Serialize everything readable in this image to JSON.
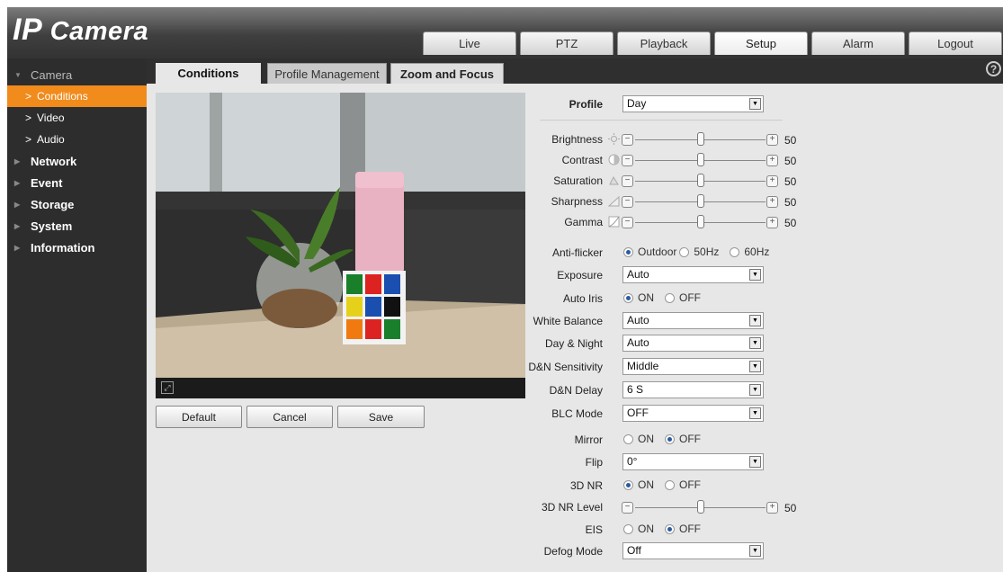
{
  "app": {
    "logo_ip": "IP",
    "logo_rest": " Camera"
  },
  "nav": {
    "tabs": [
      {
        "label": "Live",
        "active": false
      },
      {
        "label": "PTZ",
        "active": false
      },
      {
        "label": "Playback",
        "active": false
      },
      {
        "label": "Setup",
        "active": true
      },
      {
        "label": "Alarm",
        "active": false
      },
      {
        "label": "Logout",
        "active": false
      }
    ]
  },
  "sidebar": {
    "camera": "Camera",
    "sub": [
      "Conditions",
      "Video",
      "Audio"
    ],
    "items": [
      "Network",
      "Event",
      "Storage",
      "System",
      "Information"
    ]
  },
  "subtabs": {
    "conditions": "Conditions",
    "profile": "Profile Management",
    "zoom": "Zoom and Focus"
  },
  "buttons": {
    "default": "Default",
    "cancel": "Cancel",
    "save": "Save"
  },
  "settings": {
    "profile": {
      "label": "Profile",
      "value": "Day"
    },
    "brightness": {
      "label": "Brightness",
      "value": 50
    },
    "contrast": {
      "label": "Contrast",
      "value": 50
    },
    "saturation": {
      "label": "Saturation",
      "value": 50
    },
    "sharpness": {
      "label": "Sharpness",
      "value": 50
    },
    "gamma": {
      "label": "Gamma",
      "value": 50
    },
    "antiflicker": {
      "label": "Anti-flicker",
      "options": [
        "Outdoor",
        "50Hz",
        "60Hz"
      ],
      "selected": "Outdoor"
    },
    "exposure": {
      "label": "Exposure",
      "value": "Auto"
    },
    "autoiris": {
      "label": "Auto Iris",
      "options": [
        "ON",
        "OFF"
      ],
      "selected": "ON"
    },
    "whitebalance": {
      "label": "White Balance",
      "value": "Auto"
    },
    "daynight": {
      "label": "Day & Night",
      "value": "Auto"
    },
    "dnsens": {
      "label": "D&N Sensitivity",
      "value": "Middle"
    },
    "dndelay": {
      "label": "D&N Delay",
      "value": "6 S"
    },
    "blc": {
      "label": "BLC Mode",
      "value": "OFF"
    },
    "mirror": {
      "label": "Mirror",
      "options": [
        "ON",
        "OFF"
      ],
      "selected": "OFF"
    },
    "flip": {
      "label": "Flip",
      "value": "0°"
    },
    "nr3d": {
      "label": "3D NR",
      "options": [
        "ON",
        "OFF"
      ],
      "selected": "ON"
    },
    "nr3dlevel": {
      "label": "3D NR Level",
      "value": 50
    },
    "eis": {
      "label": "EIS",
      "options": [
        "ON",
        "OFF"
      ],
      "selected": "OFF"
    },
    "defog": {
      "label": "Defog Mode",
      "value": "Off"
    }
  },
  "colors": {
    "accent": "#f08b1c",
    "sidebar": "#2d2d2d",
    "header": "#3f3f3f"
  }
}
